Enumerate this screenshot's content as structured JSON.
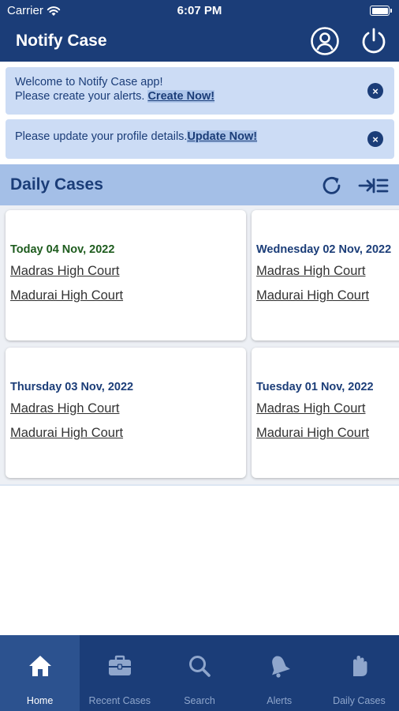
{
  "status_bar": {
    "carrier": "Carrier",
    "time": "6:07 PM"
  },
  "header": {
    "title": "Notify Case"
  },
  "banners": [
    {
      "text_line1": "Welcome to Notify Case app!",
      "text_line2": "Please create your alerts. ",
      "link": "Create Now!"
    },
    {
      "text": "Please update your profile details.",
      "link": "Update Now!"
    }
  ],
  "section": {
    "title": "Daily Cases"
  },
  "cards": [
    {
      "date": "Today 04 Nov, 2022",
      "courts": [
        "Madras High Court",
        "Madurai High Court"
      ]
    },
    {
      "date": "Wednesday 02 Nov, 2022",
      "courts": [
        "Madras High Court",
        "Madurai High Court"
      ]
    },
    {
      "date": "Thursday 03 Nov, 2022",
      "courts": [
        "Madras High Court",
        "Madurai High Court"
      ]
    },
    {
      "date": "Tuesday 01 Nov, 2022",
      "courts": [
        "Madras High Court",
        "Madurai High Court"
      ]
    }
  ],
  "tabs": [
    {
      "label": "Home",
      "icon": "home-icon"
    },
    {
      "label": "Recent Cases",
      "icon": "briefcase-icon"
    },
    {
      "label": "Search",
      "icon": "search-icon"
    },
    {
      "label": "Alerts",
      "icon": "bell-icon"
    },
    {
      "label": "Daily Cases",
      "icon": "hand-icon"
    }
  ],
  "colors": {
    "header_bg": "#1b3d78",
    "banner_bg": "#ccdcf5",
    "section_bg": "#a4bfe7",
    "today_date": "#1e5c1e",
    "tab_active_bg": "#2c528f"
  }
}
